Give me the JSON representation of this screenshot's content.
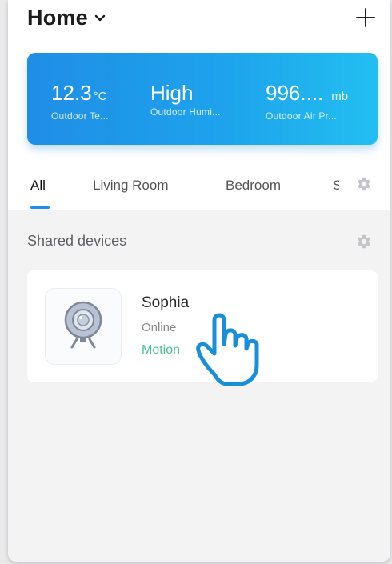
{
  "header": {
    "title": "Home"
  },
  "weather": [
    {
      "value": "12.3",
      "unit": "°C",
      "label": "Outdoor Te..."
    },
    {
      "value": "High",
      "unit": "",
      "label": "Outdoor Humi..."
    },
    {
      "value": "996....",
      "unit": "mb",
      "label": "Outdoor Air Pr..."
    }
  ],
  "tabs": [
    {
      "label": "All",
      "active": true
    },
    {
      "label": "Living Room"
    },
    {
      "label": "Bedroom"
    },
    {
      "label": "S"
    }
  ],
  "section": {
    "title": "Shared devices"
  },
  "device": {
    "name": "Sophia",
    "status": "Online",
    "event": "Motion"
  },
  "colors": {
    "accent": "#1e8fe6",
    "event": "#47c28f",
    "card_gradient_start": "#1f8ee6",
    "card_gradient_end": "#22bff1"
  },
  "icons": [
    "chevron-down-icon",
    "plus-icon",
    "gear-icon",
    "camera-icon",
    "pointer-hand-icon"
  ]
}
